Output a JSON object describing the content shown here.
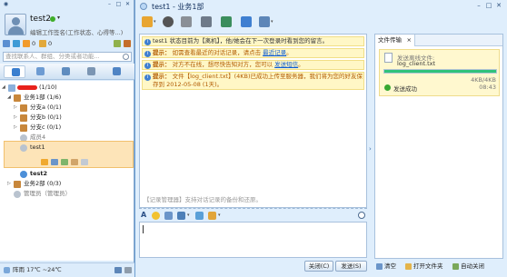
{
  "left": {
    "username": "test2",
    "signature": "编辑工作签名(工作状态、心得等...)",
    "counts": {
      "messages": "0",
      "alerts": "0"
    },
    "search_placeholder": "查找联系人、群组、分类或者功能...",
    "tree": {
      "root": "(1/10)",
      "dept1": "业务1部 (1/6)",
      "sub_a": "分支a (0/1)",
      "sub_b": "分支b (0/1)",
      "sub_c": "分支c (0/1)",
      "member4": "成员4",
      "selected_user": "test1",
      "current_user": "test2",
      "dept2": "业务2部 (0/3)",
      "admin": "管理员（管理员）"
    },
    "status_bar": "阵雨 17℃ ~24℃"
  },
  "chat": {
    "title": "test1 - 业务1部",
    "notices": [
      {
        "text": "test1 状态目前为【离机】，他/她会在下一次登录时看到您的留言。",
        "style": "dark"
      },
      {
        "prefix": "提示：",
        "text": "如需查看最近的对话记录，请点击",
        "link": "最近记录",
        "suffix": "。"
      },
      {
        "prefix": "提示：",
        "text": "对方不在线，想尽快告知对方，您可以",
        "link": "发送短信",
        "suffix": "。"
      },
      {
        "prefix": "提示：",
        "text": "文件【log_client.txt】(4KB)已成功上传至服务器，我们将为您的好友保存到 2012-05-08 (1天)。"
      }
    ],
    "history_tip": "【记录管理器】支持对话记录的备份和还原。",
    "close_button": "关闭(C)",
    "send_button": "发送(S)"
  },
  "file_panel": {
    "tab": "文件传输",
    "line1": "发送离线文件:",
    "filename": "log_client.txt",
    "progress": 1.0,
    "size": "4KB/4KB",
    "status": "发送成功",
    "time": "08:43",
    "clear": "清空",
    "open_folder": "打开文件夹",
    "auto_close": "自动关闭"
  },
  "colors": {
    "accent": "#2fc27a",
    "notice_bg": "#fff7c6",
    "notice_text": "#b15a00",
    "link": "#0b5bd3",
    "selected_bg": "#fde4b8"
  }
}
